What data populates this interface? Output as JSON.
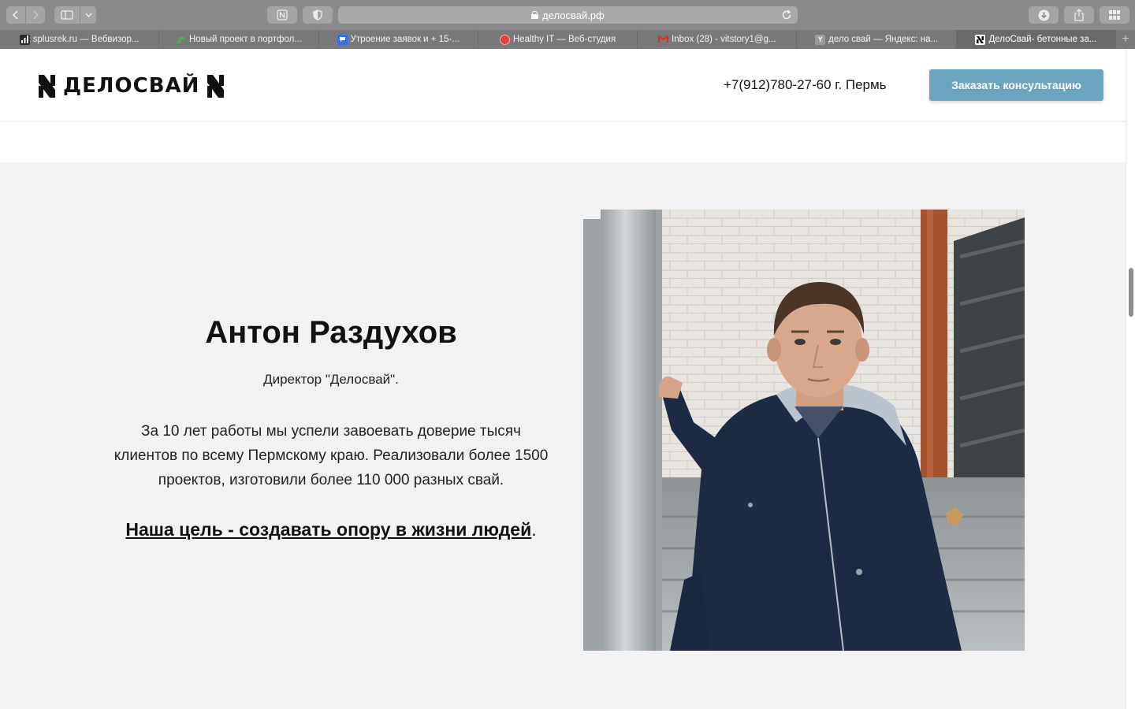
{
  "browser": {
    "url": "делосвай.рф",
    "tabs": [
      {
        "label": "splusrek.ru — Вебвизор...",
        "favicon": "bar-chart-icon",
        "color": "#2a2a2a"
      },
      {
        "label": "Новый проект в портфол...",
        "favicon": "leaf-icon",
        "color": "#45b74a"
      },
      {
        "label": "Утроение заявок и + 15-...",
        "favicon": "chat-bubble-icon",
        "color": "#2f6ff0"
      },
      {
        "label": "Healthy IT — Веб-студия",
        "favicon": "red-circle-icon",
        "color": "#e8403a"
      },
      {
        "label": "Inbox (28) - vitstory1@g...",
        "favicon": "gmail-icon",
        "color": "#d93025"
      },
      {
        "label": "дело свай — Яндекс: на...",
        "favicon": "yandex-icon",
        "color": "#9a9a9a"
      },
      {
        "label": "ДелоСвай- бетонные за...",
        "favicon": "delosvai-logo-icon",
        "color": "#ffffff",
        "active": true
      }
    ]
  },
  "header": {
    "logo_text": "ДЕЛОСВАЙ",
    "phone": "+7(912)780-27-60 г. Пермь",
    "cta_label": "Заказать консультацию",
    "cta_color": "#6aa4c0"
  },
  "about": {
    "name": "Антон Раздухов",
    "role": "Директор \"Делосвай\".",
    "description": "За 10 лет работы мы успели завоевать доверие тысяч клиентов по всему Пермскому краю. Реализовали более 1500 проектов, изготовили более 110 000 разных свай.",
    "goal_link": "Наша цель - создавать опору в жизни людей",
    "goal_suffix": ".",
    "background": "#f2f2f2"
  }
}
